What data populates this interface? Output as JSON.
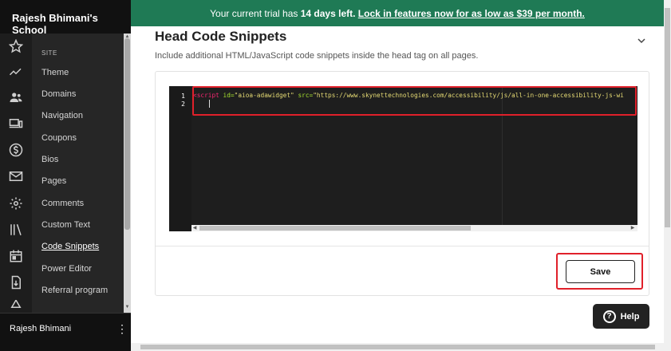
{
  "sidebar": {
    "school_name": "Rajesh Bhimani's School",
    "section_label": "SITE",
    "rail_icons": [
      "star-icon",
      "trend-icon",
      "users-icon",
      "devices-icon",
      "dollar-icon",
      "mail-icon",
      "gear-icon",
      "library-icon",
      "calendar-icon",
      "download-icon",
      "shapes-icon"
    ],
    "items": [
      {
        "label": "Theme"
      },
      {
        "label": "Domains"
      },
      {
        "label": "Navigation"
      },
      {
        "label": "Coupons"
      },
      {
        "label": "Bios"
      },
      {
        "label": "Pages"
      },
      {
        "label": "Comments"
      },
      {
        "label": "Custom Text"
      },
      {
        "label": "Code Snippets",
        "active": true
      },
      {
        "label": "Power Editor"
      },
      {
        "label": "Referral program"
      }
    ],
    "user_name": "Rajesh Bhimani",
    "user_menu_icon": "⋮"
  },
  "banner": {
    "prefix": "Your current trial has ",
    "days": "14 days left.",
    "link": "Lock in features now for as low as $39 per month."
  },
  "main": {
    "title": "Head Code Snippets",
    "subtitle": "Include additional HTML/JavaScript code snippets inside the head tag on all pages.",
    "editor": {
      "line_numbers": [
        "1",
        "2"
      ],
      "code": {
        "open": "<script",
        "attr1": " id=",
        "val1": "\"aioa-adawidget\"",
        "attr2": " src=",
        "val2": "\"https://www.skynettechnologies.com/accessibility/js/all-in-one-accessibility-js-wi"
      }
    },
    "save_label": "Save"
  },
  "help": {
    "label": "Help",
    "icon_glyph": "?"
  },
  "colors": {
    "banner": "#1f7a55",
    "highlight": "#e0202a",
    "sidebar": "#262626"
  }
}
